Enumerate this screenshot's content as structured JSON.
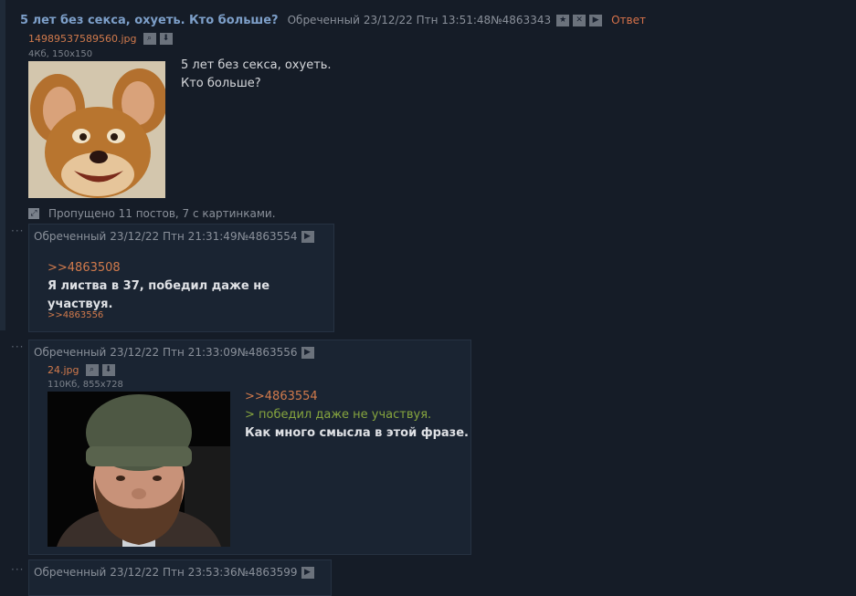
{
  "op": {
    "title": "5 лет без секса, охуеть. Кто больше?",
    "author": "Обреченный",
    "date": "23/12/22 Птн 13:51:48",
    "number": "№4863343",
    "reply_label": "Ответ",
    "file": {
      "name": "14989537589560.jpg",
      "info": "4Кб, 150x150"
    },
    "message": [
      "5 лет без секса, охуеть.",
      "Кто больше?"
    ]
  },
  "skipped": "Пропущено 11 постов, 7 с картинками.",
  "posts": [
    {
      "author": "Обреченный",
      "date": "23/12/22 Птн 21:31:49",
      "number": "№4863554",
      "reply_ref": ">>4863508",
      "text": "Я листва в 37, победил даже не участвуя.",
      "backlink": ">>4863556"
    },
    {
      "author": "Обреченный",
      "date": "23/12/22 Птн 21:33:09",
      "number": "№4863556",
      "file": {
        "name": "24.jpg",
        "info": "110Кб, 855x728"
      },
      "reply_ref": ">>4863554",
      "quote": "> победил даже не участвуя.",
      "text": "Как много смысла в этой фразе."
    },
    {
      "author": "Обреченный",
      "date": "23/12/22 Птн 23:53:36",
      "number": "№4863599"
    }
  ],
  "icons": {
    "favorite": "star-icon",
    "hide": "close-icon",
    "menu": "play-icon",
    "search": "search-icon",
    "download": "download-icon",
    "expand": "expand-icon",
    "dots": "dots-icon"
  },
  "colors": {
    "background": "#151c27",
    "post_background": "#1a2432",
    "title": "#7d9fc9",
    "link": "#d17a4c",
    "quote": "#86a53e",
    "text": "#d6d8dc",
    "meta": "#8a909a"
  }
}
